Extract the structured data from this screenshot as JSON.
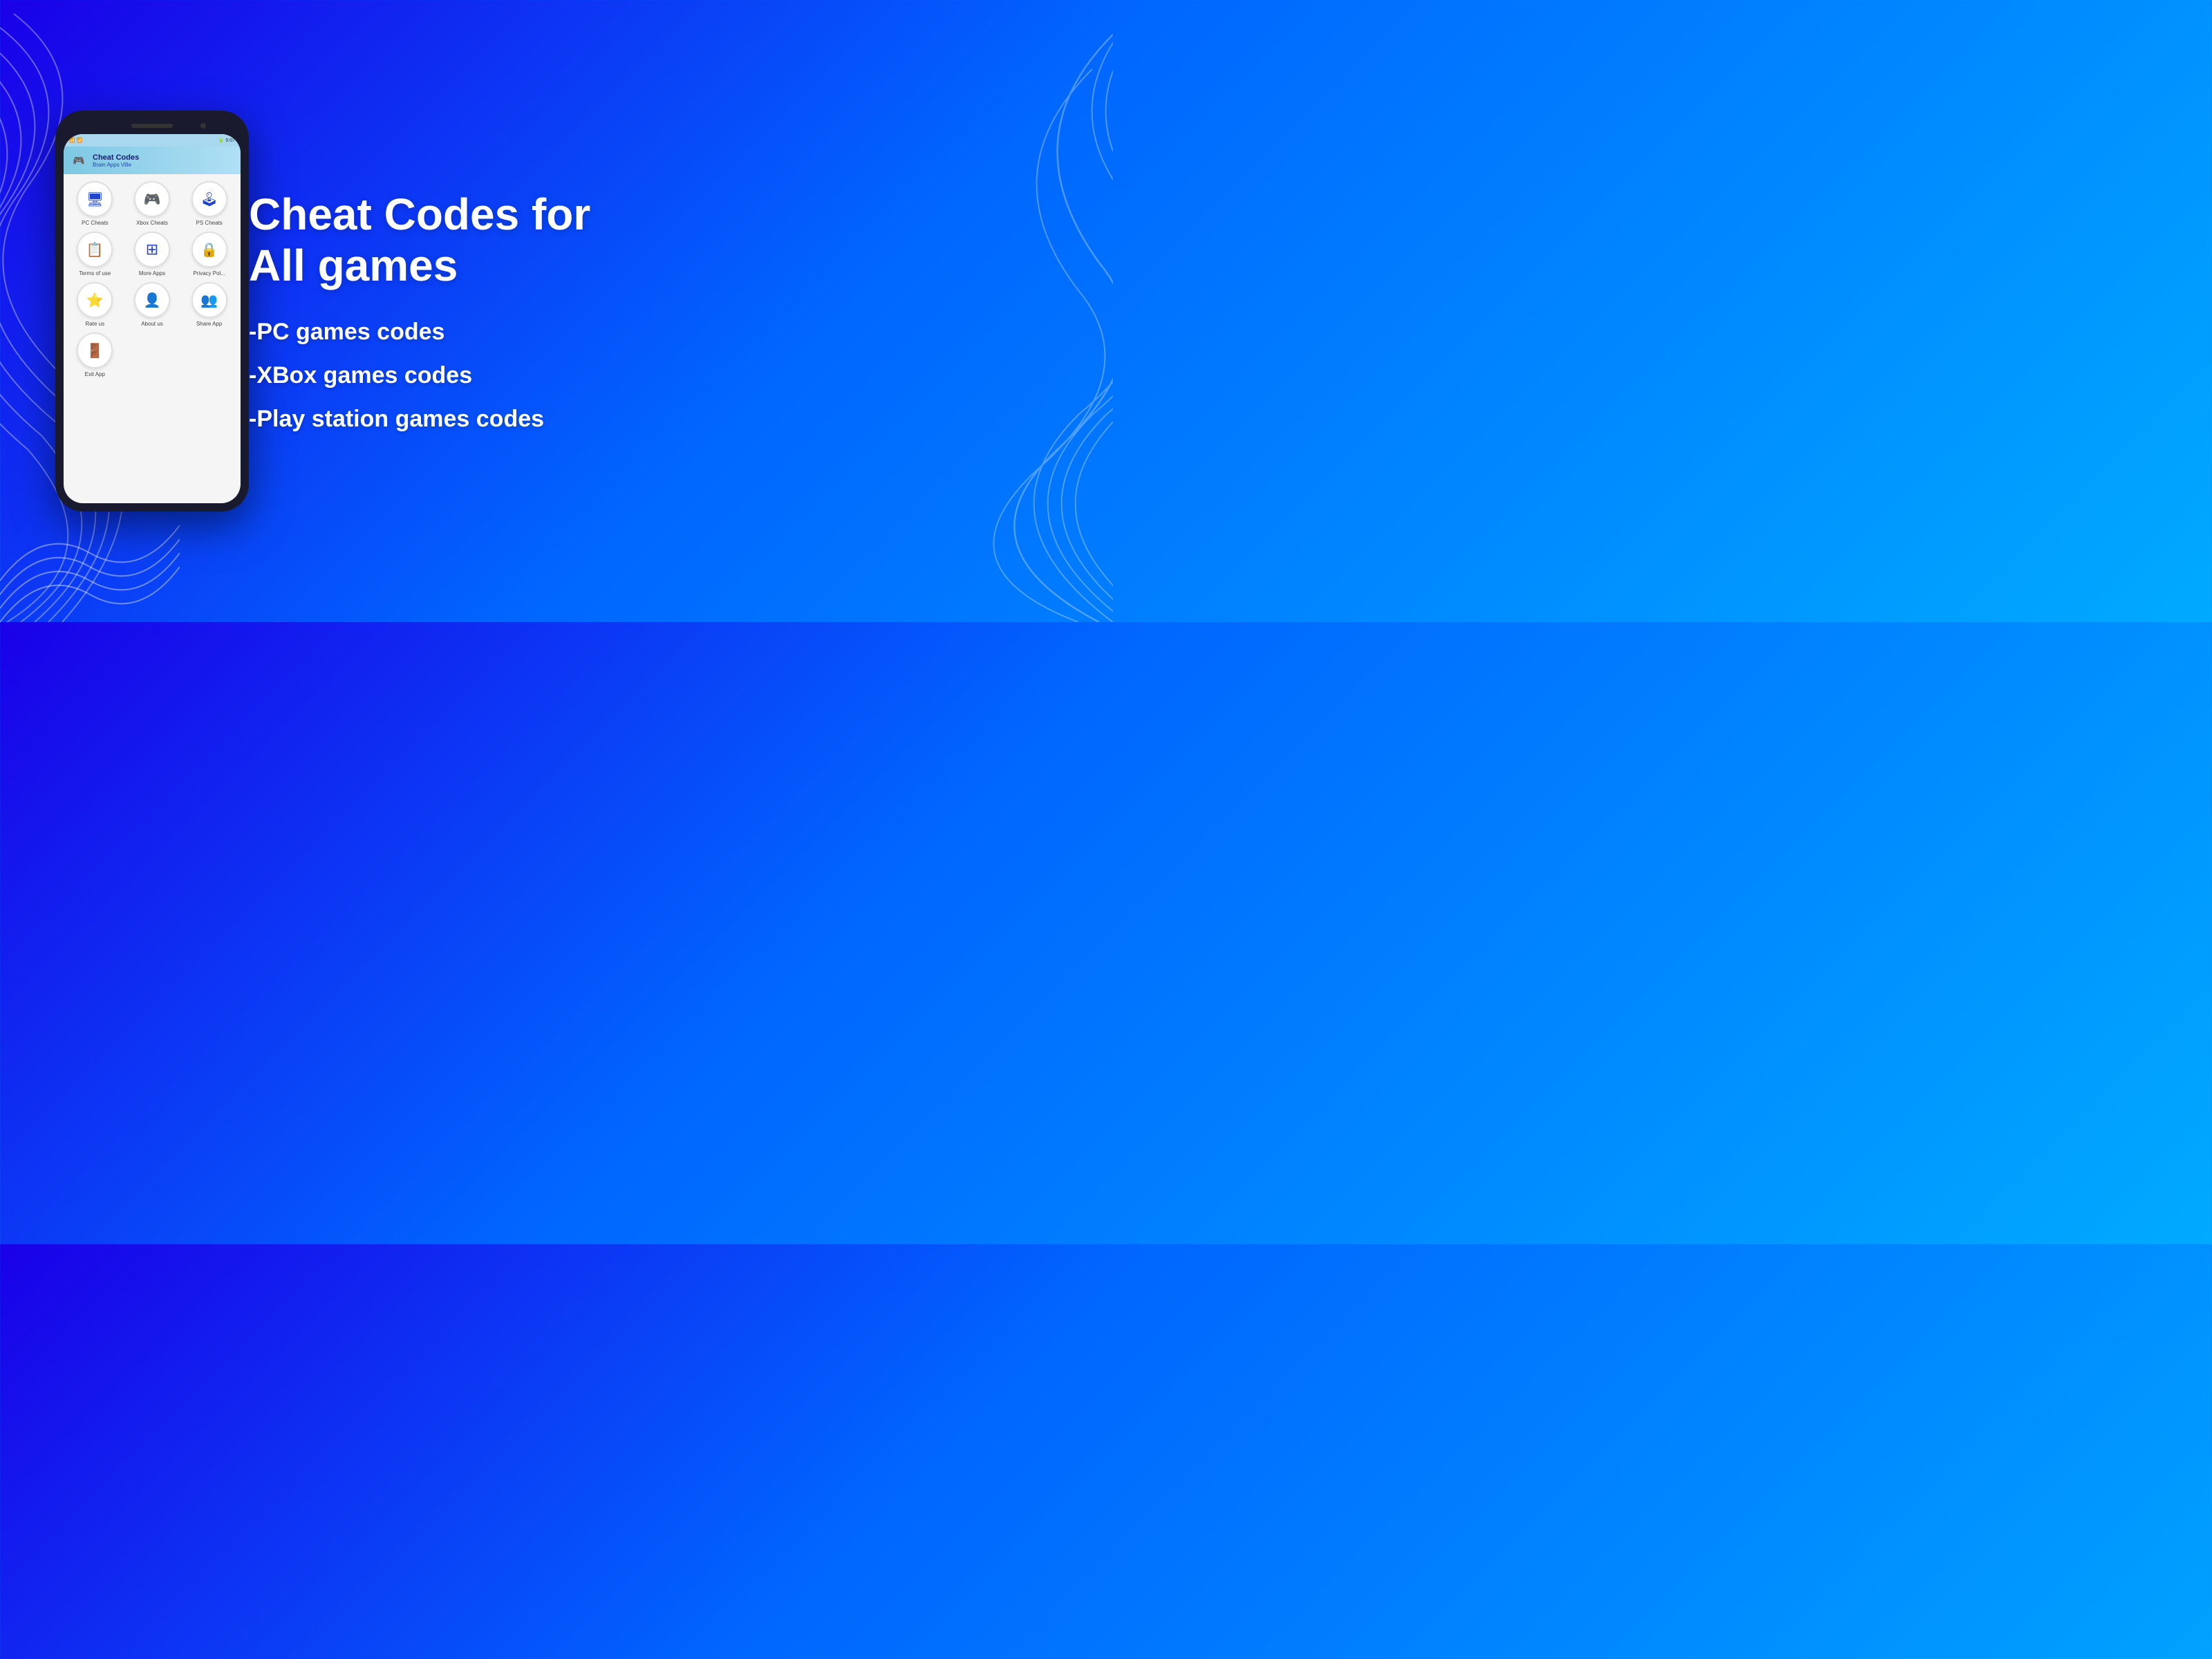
{
  "background": {
    "gradient_start": "#1a00e8",
    "gradient_end": "#00aaff"
  },
  "phone": {
    "header": {
      "title": "Cheat Codes",
      "subtitle": "Brain Apps Ville"
    },
    "status_bar": {
      "left": "📶 📶",
      "right": "🔋 9:07"
    },
    "grid_items": [
      {
        "label": "PC Cheats",
        "icon": "🖥"
      },
      {
        "label": "Xbox Cheats",
        "icon": "🎮"
      },
      {
        "label": "PS Cheats",
        "icon": "🕹"
      },
      {
        "label": "Terms of use",
        "icon": "📋"
      },
      {
        "label": "More Apps",
        "icon": "⊞"
      },
      {
        "label": "Privacy Pol...",
        "icon": "🔒"
      },
      {
        "label": "Rate us",
        "icon": "⭐"
      },
      {
        "label": "About us",
        "icon": "👤"
      },
      {
        "label": "Share App",
        "icon": "👥"
      },
      {
        "label": "Exit App",
        "icon": "🚪"
      }
    ]
  },
  "headline": {
    "line1": "Cheat Codes for",
    "line2": "All games"
  },
  "features": [
    "-PC games codes",
    "-XBox games codes",
    "-Play station games codes"
  ]
}
